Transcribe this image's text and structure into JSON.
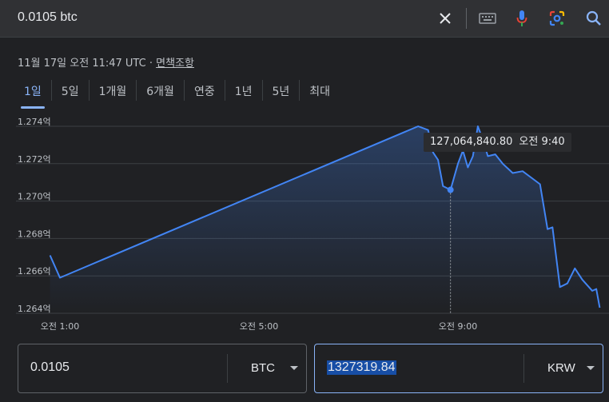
{
  "search": {
    "query": "0.0105 btc"
  },
  "meta": {
    "timestamp": "11월 17일 오전 11:47 UTC",
    "separator": " · ",
    "disclaimer": "면책조항"
  },
  "tabs": [
    {
      "label": "1일"
    },
    {
      "label": "5일"
    },
    {
      "label": "1개월"
    },
    {
      "label": "6개월"
    },
    {
      "label": "연중"
    },
    {
      "label": "1년"
    },
    {
      "label": "5년"
    },
    {
      "label": "최대"
    }
  ],
  "tooltip": {
    "value": "127,064,840.80",
    "time": "오전 9:40"
  },
  "chart_data": {
    "type": "line",
    "y_ticks": [
      "1.274억",
      "1.272억",
      "1.270억",
      "1.268억",
      "1.266억",
      "1.264억"
    ],
    "x_ticks": [
      "오전 1:00",
      "오전 5:00",
      "오전 9:00"
    ],
    "ylim": [
      126400000,
      127400000
    ],
    "series": [
      {
        "values": [
          [
            0.8,
            126710000
          ],
          [
            1.0,
            126590000
          ],
          [
            8.2,
            127400000
          ],
          [
            8.4,
            127380000
          ],
          [
            8.5,
            127260000
          ],
          [
            8.6,
            127220000
          ],
          [
            8.7,
            127080000
          ],
          [
            8.85,
            127060000
          ],
          [
            9.0,
            127200000
          ],
          [
            9.1,
            127270000
          ],
          [
            9.2,
            127180000
          ],
          [
            9.3,
            127240000
          ],
          [
            9.4,
            127400000
          ],
          [
            9.5,
            127330000
          ],
          [
            9.6,
            127240000
          ],
          [
            9.75,
            127250000
          ],
          [
            9.9,
            127200000
          ],
          [
            10.1,
            127150000
          ],
          [
            10.3,
            127160000
          ],
          [
            10.5,
            127120000
          ],
          [
            10.65,
            127090000
          ],
          [
            10.8,
            126850000
          ],
          [
            10.9,
            126860000
          ],
          [
            11.05,
            126540000
          ],
          [
            11.2,
            126560000
          ],
          [
            11.35,
            126640000
          ],
          [
            11.5,
            126580000
          ],
          [
            11.7,
            126520000
          ],
          [
            11.78,
            126530000
          ],
          [
            11.85,
            126430000
          ]
        ]
      }
    ],
    "accent_color": "#4285f4"
  },
  "converter": {
    "from": {
      "value": "0.0105",
      "unit": "BTC"
    },
    "to": {
      "value": "1327319.84",
      "unit": "KRW"
    }
  }
}
